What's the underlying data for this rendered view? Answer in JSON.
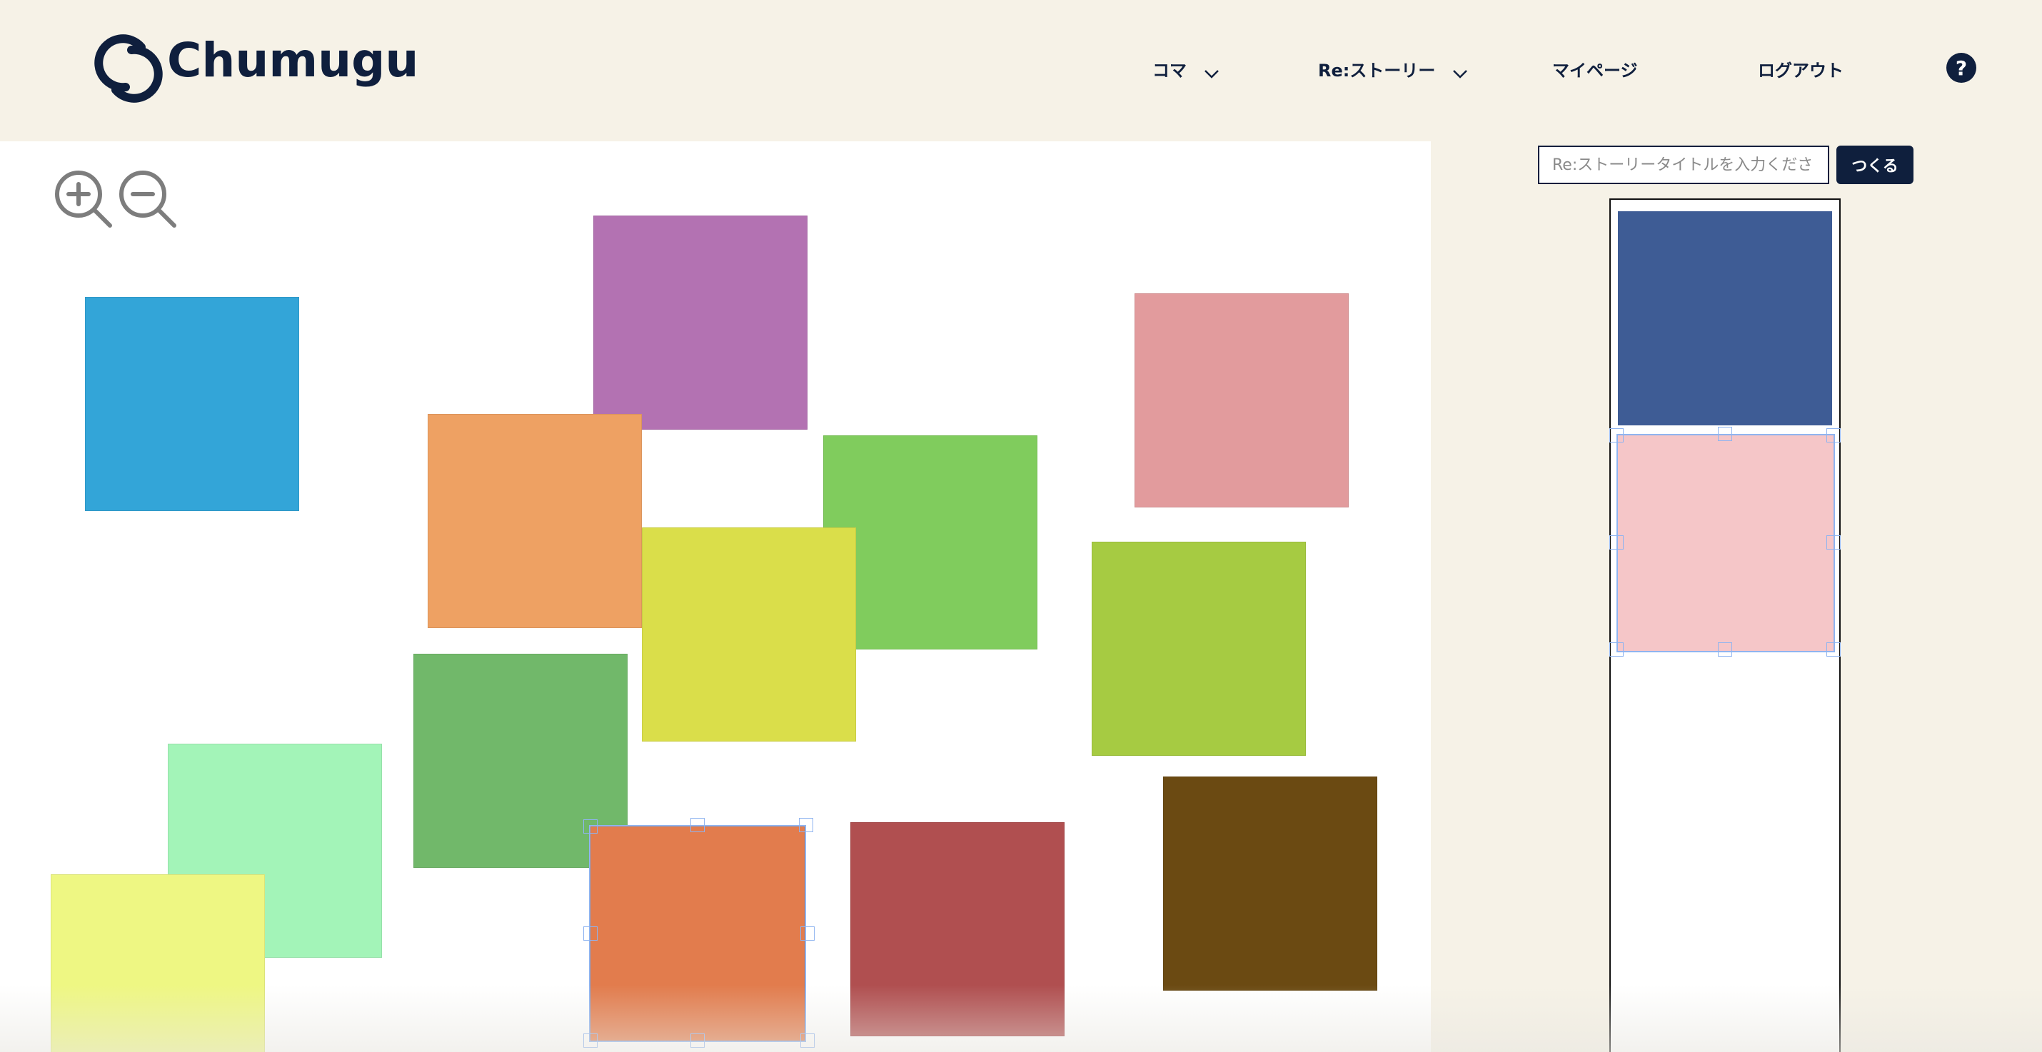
{
  "header": {
    "logo_text": "Chumugu",
    "nav": {
      "koma": "コマ",
      "restory": "Re:ストーリー",
      "mypage": "マイページ",
      "logout": "ログアウト"
    },
    "help_label": "?"
  },
  "canvas": {
    "zoom_in_icon": "zoom-in-icon",
    "zoom_out_icon": "zoom-out-icon",
    "panels": [
      {
        "name": "panel-blue",
        "color": "#33a5d8"
      },
      {
        "name": "panel-purple",
        "color": "#b372b2"
      },
      {
        "name": "panel-pink",
        "color": "#e29b9d"
      },
      {
        "name": "panel-orange",
        "color": "#eea163"
      },
      {
        "name": "panel-green",
        "color": "#80cc5d"
      },
      {
        "name": "panel-yellow",
        "color": "#dade4a"
      },
      {
        "name": "panel-lime",
        "color": "#a6cb42"
      },
      {
        "name": "panel-forest",
        "color": "#71b86a"
      },
      {
        "name": "panel-mint",
        "color": "#a3f4b8"
      },
      {
        "name": "panel-lightyellow",
        "color": "#eef783"
      },
      {
        "name": "panel-coral",
        "color": "#e27c4d"
      },
      {
        "name": "panel-red",
        "color": "#b04f50"
      },
      {
        "name": "panel-brown",
        "color": "#6b4a12"
      }
    ]
  },
  "story": {
    "title_placeholder": "Re:ストーリータイトルを入力ください",
    "title_value": "",
    "make_button": "つくる",
    "panels": [
      {
        "name": "story-panel-navy",
        "color": "#3e5c95"
      },
      {
        "name": "story-panel-lightpink",
        "color": "#f5c6c8"
      }
    ]
  },
  "colors": {
    "brand_navy": "#0f1f3d",
    "background": "#f6f2e7",
    "selection": "#8fb4f0"
  }
}
